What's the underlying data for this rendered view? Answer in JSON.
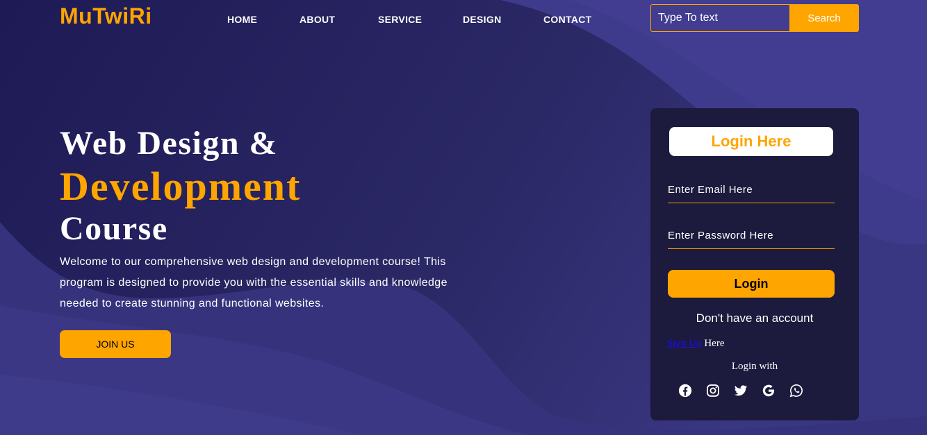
{
  "brand": {
    "logo": "MuTwiRi"
  },
  "nav": {
    "items": [
      "HOME",
      "ABOUT",
      "SERVICE",
      "DESIGN",
      "CONTACT"
    ]
  },
  "search": {
    "placeholder": "Type To text",
    "button_label": "Search"
  },
  "hero": {
    "line1": "Web Design &",
    "line2": "Development",
    "line3": "Course",
    "description": "Welcome to our comprehensive web design and development course! This program is designed to provide you with the essential skills and knowledge needed to create stunning and functional websites.",
    "cta_label": "JOIN US"
  },
  "login": {
    "title": "Login Here",
    "email_placeholder": "Enter Email Here",
    "password_placeholder": "Enter Password Here",
    "button_label": "Login",
    "no_account_text": "Don't have an account",
    "signup_link": "Sign Up",
    "signup_suffix": " Here",
    "login_with": "Login with",
    "social_icons": [
      "facebook-icon",
      "instagram-icon",
      "twitter-icon",
      "google-icon",
      "whatsapp-icon"
    ]
  },
  "colors": {
    "accent": "#ffa500",
    "background": "#23205a",
    "panel": "#1c1a3d",
    "link": "#1a0dff"
  }
}
